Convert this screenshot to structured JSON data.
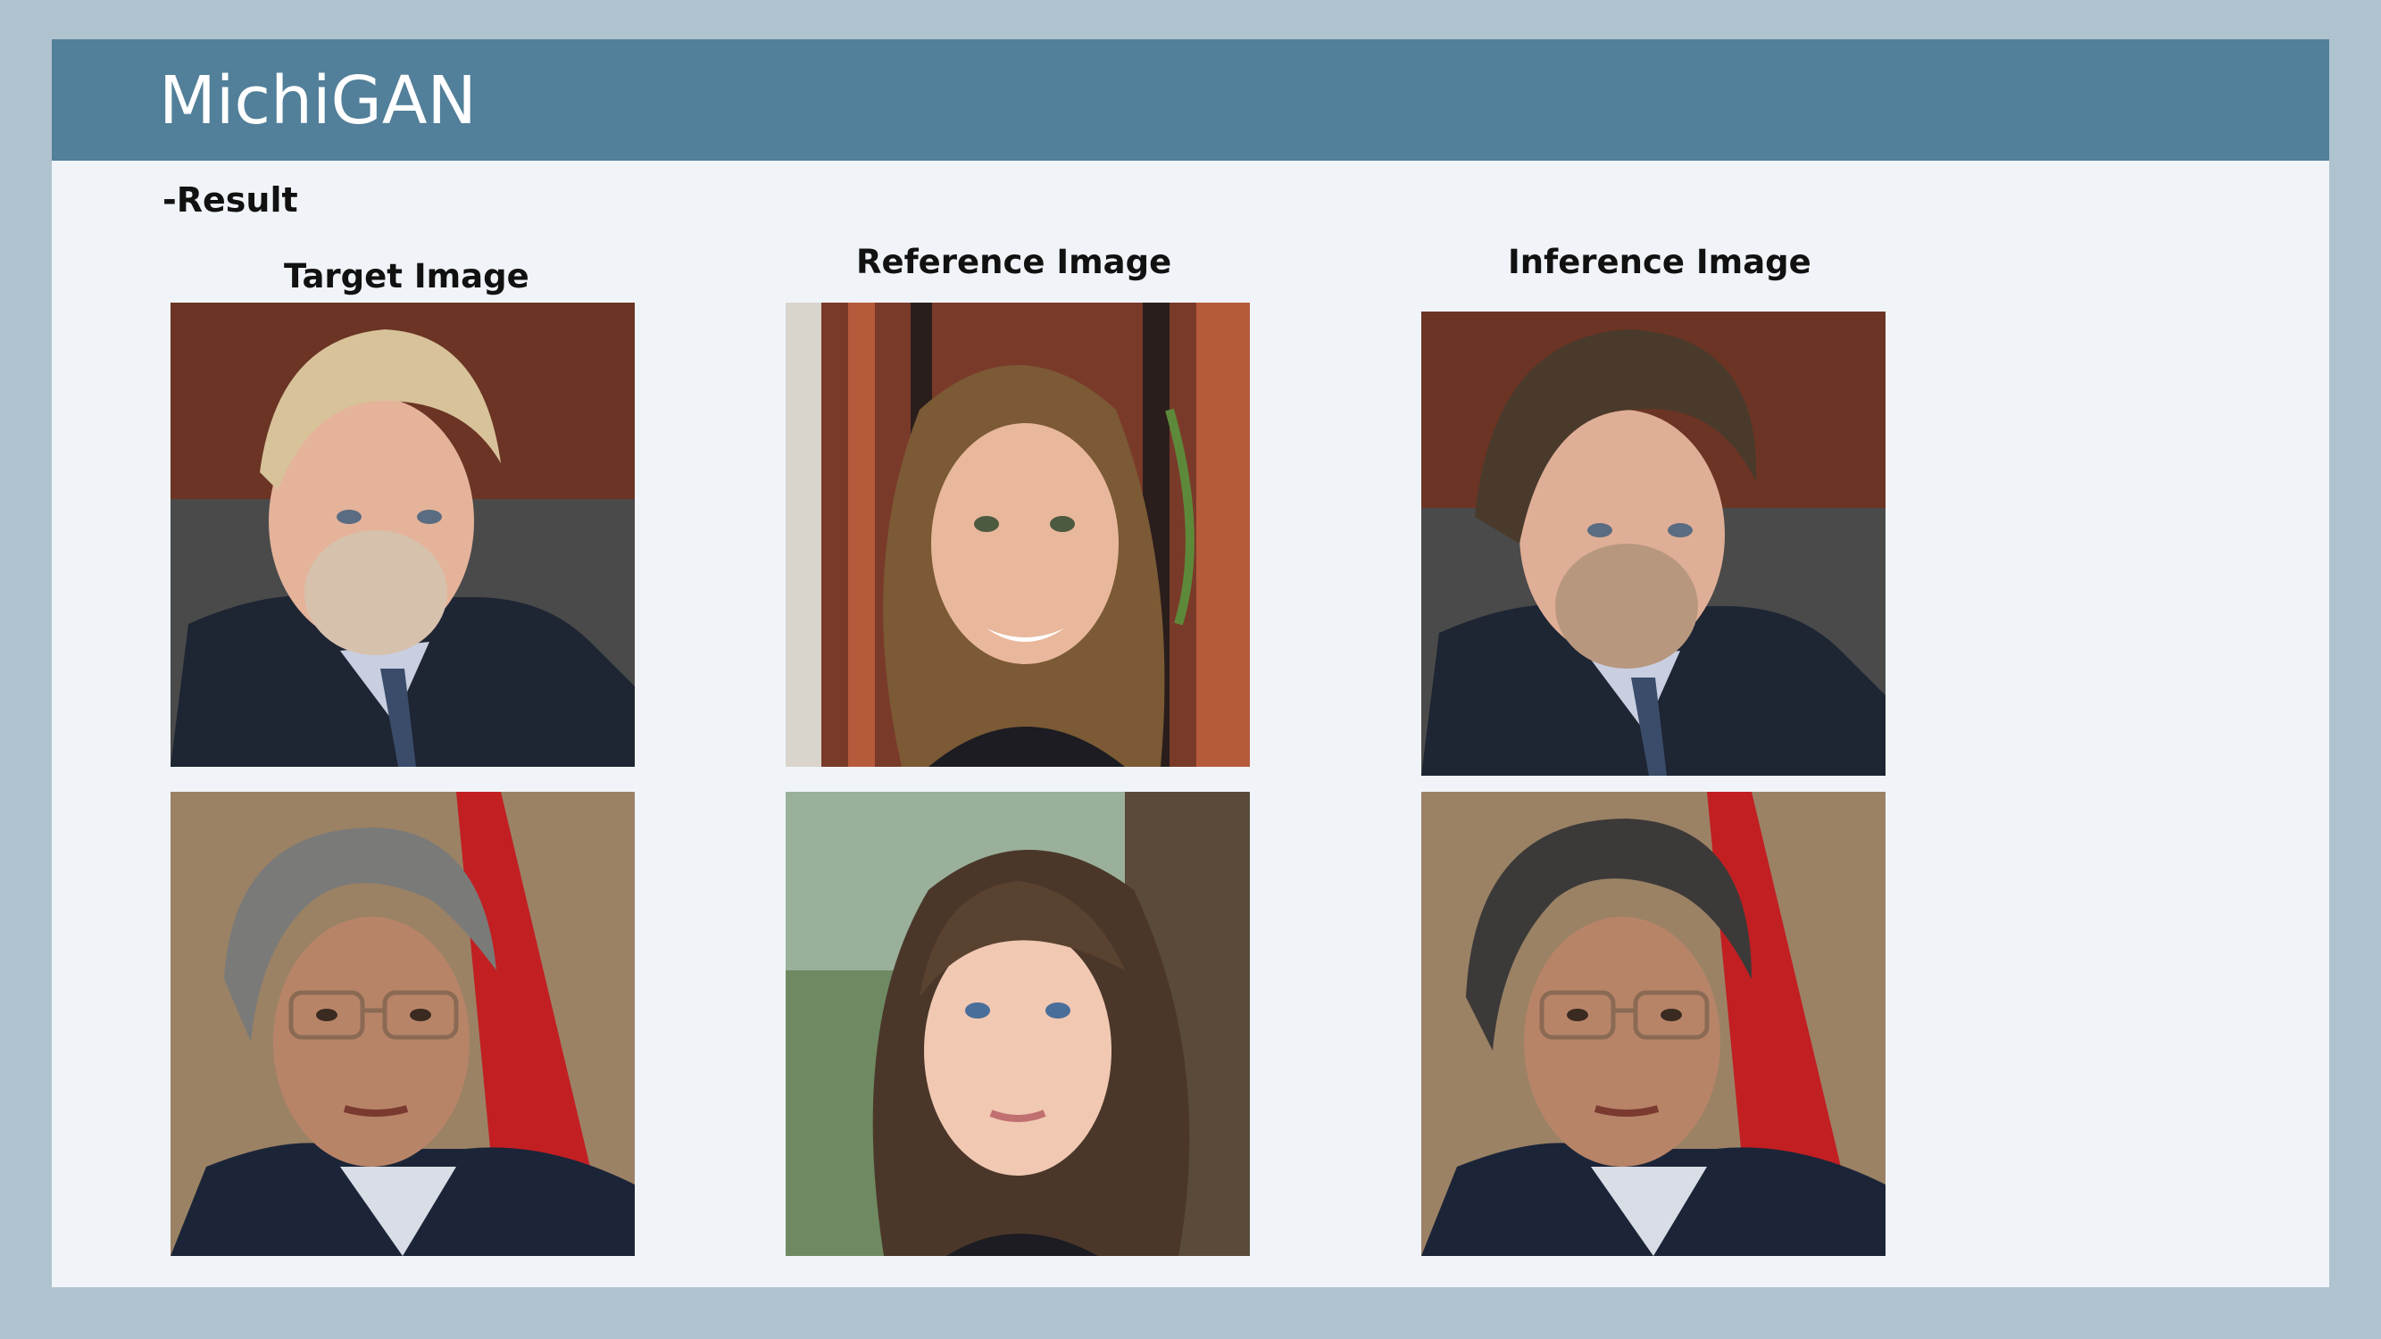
{
  "slide": {
    "title": "MichiGAN",
    "subtitle": "-Result"
  },
  "columns": {
    "target_label": "Target Image",
    "reference_label": "Reference Image",
    "inference_label": "Inference Image"
  },
  "colors": {
    "background": "#aec3ce",
    "header": "#527f99",
    "slide": "#f0f4f8"
  },
  "rows": [
    {
      "target": "photo of older man with blond-gray hair in suit",
      "reference": "photo of smiling woman with long light-brown hair",
      "inference": "photo of same man with darker brown hair"
    },
    {
      "target": "photo of man with gray hair and glasses in front of red flag",
      "reference": "photo of woman with long brown hair and highlights",
      "inference": "photo of same man with fuller dark hair"
    }
  ]
}
